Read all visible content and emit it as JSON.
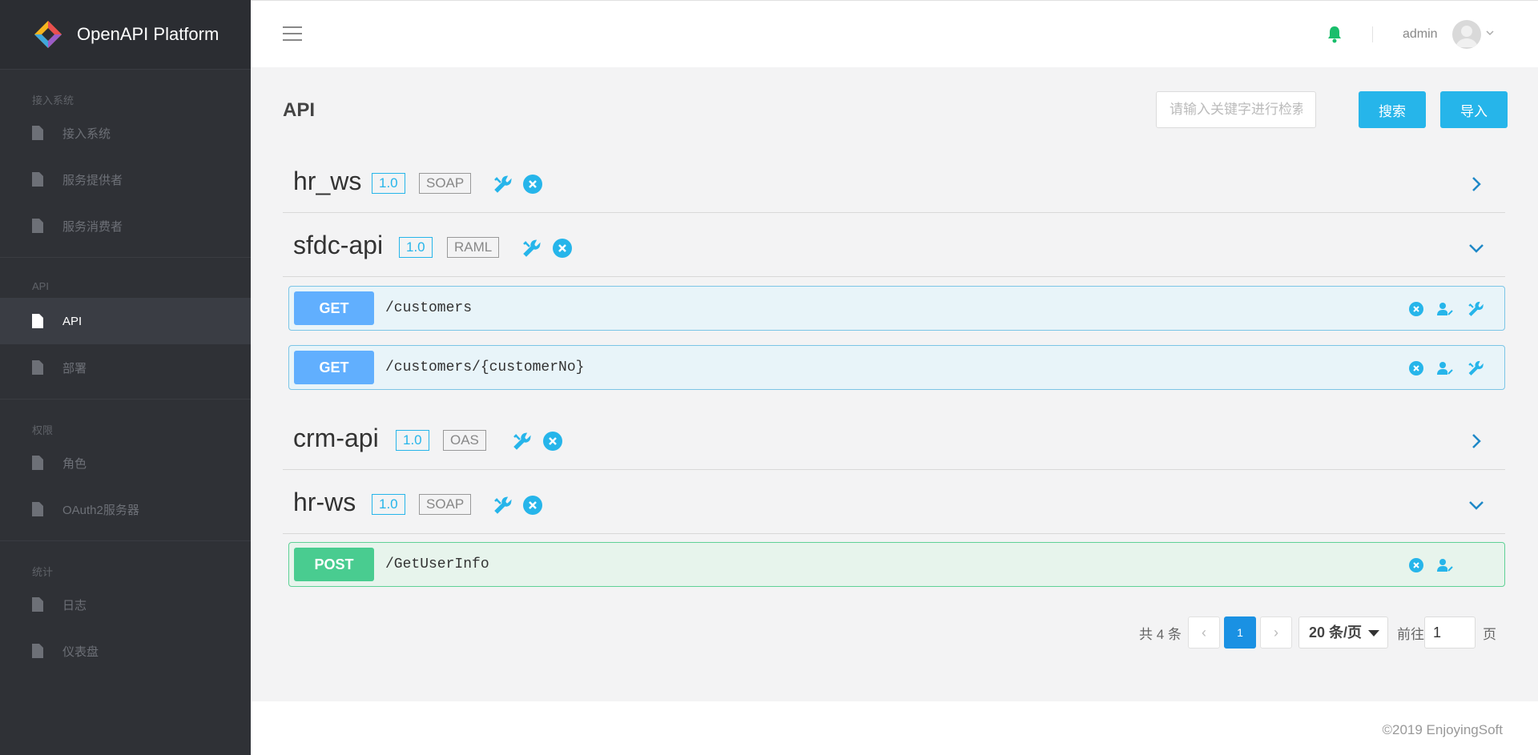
{
  "app": {
    "title": "OpenAPI Platform"
  },
  "sidebar": {
    "groups": [
      {
        "title": "接入系统",
        "items": [
          {
            "label": "接入系统"
          },
          {
            "label": "服务提供者"
          },
          {
            "label": "服务消费者"
          }
        ]
      },
      {
        "title": "API",
        "items": [
          {
            "label": "API"
          },
          {
            "label": "部署"
          }
        ]
      },
      {
        "title": "权限",
        "items": [
          {
            "label": "角色"
          },
          {
            "label": "OAuth2服务器"
          }
        ]
      },
      {
        "title": "统计",
        "items": [
          {
            "label": "日志"
          },
          {
            "label": "仪表盘"
          }
        ]
      }
    ]
  },
  "header": {
    "username": "admin"
  },
  "main": {
    "title": "API",
    "search_placeholder": "请输入关键字进行检索",
    "search_label": "搜索",
    "import_label": "导入"
  },
  "apis": [
    {
      "name": "hr_ws",
      "version": "1.0",
      "type": "SOAP",
      "expanded": false
    },
    {
      "name": "sfdc-api",
      "version": "1.0",
      "type": "RAML",
      "expanded": true,
      "operations": [
        {
          "method": "GET",
          "path": "/customers"
        },
        {
          "method": "GET",
          "path": "/customers/{customerNo}"
        }
      ]
    },
    {
      "name": "crm-api",
      "version": "1.0",
      "type": "OAS",
      "expanded": false
    },
    {
      "name": "hr-ws",
      "version": "1.0",
      "type": "SOAP",
      "expanded": true,
      "operations": [
        {
          "method": "POST",
          "path": "/GetUserInfo"
        }
      ]
    }
  ],
  "pagination": {
    "total": "共 4 条",
    "prev": "‹",
    "current": "1",
    "next": "›",
    "page_size": "20 条/页",
    "goto_label": "前往",
    "goto_value": "1",
    "page_suffix": "页"
  },
  "footer": {
    "copyright": "©2019 EnjoyingSoft"
  },
  "colors": {
    "accent": "#26b5ea",
    "get": "#61affe",
    "post": "#49cc90",
    "sidebar": "#2f3136",
    "bell": "#19be6b"
  },
  "icons": [
    "logo-icon",
    "menu-icon",
    "bell-icon",
    "avatar-icon",
    "file-icon",
    "wrench-icon",
    "close-circle-icon",
    "user-edit-icon",
    "chevron-right-icon",
    "chevron-down-icon"
  ]
}
